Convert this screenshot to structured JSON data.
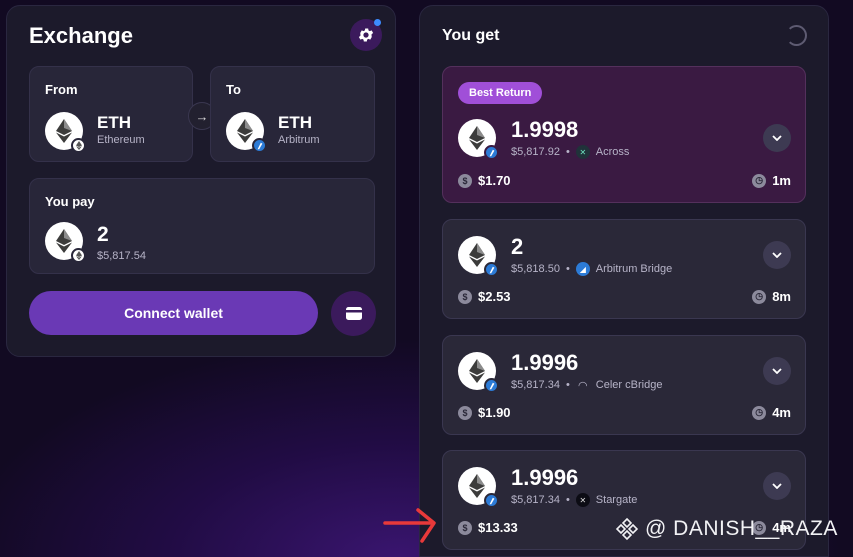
{
  "exchange": {
    "title": "Exchange",
    "from": {
      "label": "From",
      "symbol": "ETH",
      "network": "Ethereum"
    },
    "to": {
      "label": "To",
      "symbol": "ETH",
      "network": "Arbitrum"
    },
    "pay": {
      "label": "You pay",
      "amount": "2",
      "usd_value": "$5,817.54"
    },
    "connect_label": "Connect wallet"
  },
  "results": {
    "title": "You get",
    "best_badge": "Best Return",
    "routes": [
      {
        "amount": "1.9998",
        "usd_value": "$5,817.92",
        "bridge": "Across",
        "fee": "$1.70",
        "time": "1m",
        "bridge_icon": "across-icon"
      },
      {
        "amount": "2",
        "usd_value": "$5,818.50",
        "bridge": "Arbitrum Bridge",
        "fee": "$2.53",
        "time": "8m",
        "bridge_icon": "arbitrum-icon"
      },
      {
        "amount": "1.9996",
        "usd_value": "$5,817.34",
        "bridge": "Celer cBridge",
        "fee": "$1.90",
        "time": "4m",
        "bridge_icon": "celer-icon"
      },
      {
        "amount": "1.9996",
        "usd_value": "$5,817.34",
        "bridge": "Stargate",
        "fee": "$13.33",
        "time": "4m",
        "bridge_icon": "stargate-icon"
      }
    ]
  },
  "watermark": "@ DANISH__RAZA",
  "colors": {
    "accent": "#6a39b5",
    "badge": "#a04fd8",
    "notification": "#3d8bff",
    "annotation": "#e8393a"
  }
}
